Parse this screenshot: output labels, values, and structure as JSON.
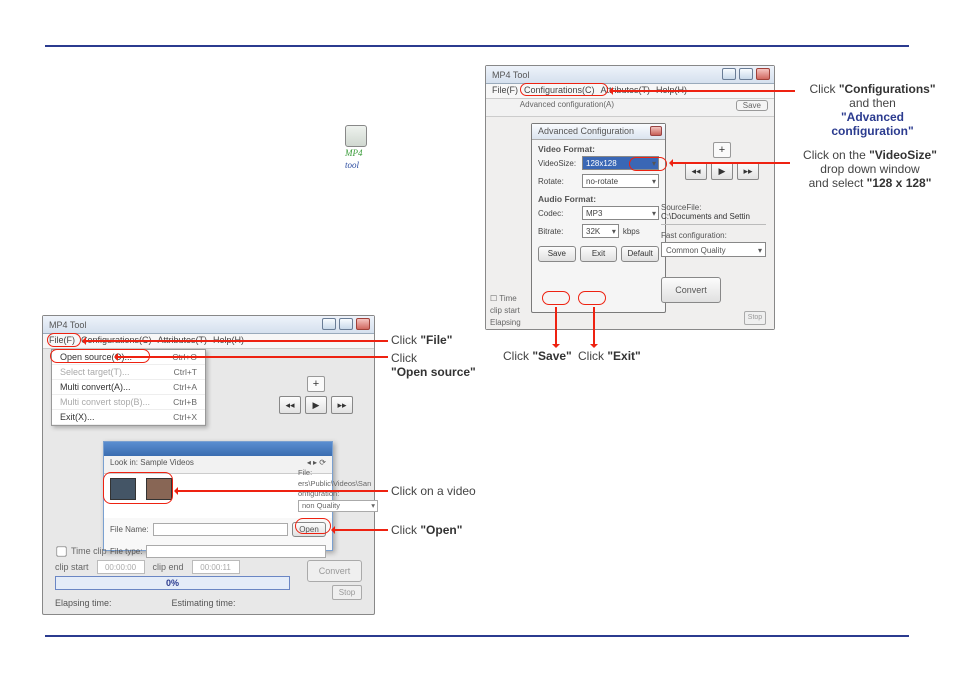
{
  "mp4_icon": {
    "line1": "MP4",
    "line2": "tool"
  },
  "top_window": {
    "title": "MP4 Tool",
    "menu": [
      "File(F)",
      "Configurations(C)",
      "Attributes(T)",
      "Help(H)"
    ],
    "toolbar_hint": "Advanced configuration(A)",
    "save_button": "Save",
    "adv_dialog": {
      "title": "Advanced Configuration",
      "video_section": "Video Format:",
      "videosize_label": "VideoSize:",
      "videosize_value": "128x128",
      "rotate_label": "Rotate:",
      "rotate_value": "no-rotate",
      "audio_section": "Audio Format:",
      "codec_label": "Codec:",
      "codec_value": "MP3",
      "bitrate_label": "Bitrate:",
      "bitrate_value": "32K",
      "bitrate_unit": "kbps",
      "buttons": {
        "save": "Save",
        "exit": "Exit",
        "default": "Default"
      }
    },
    "right_panel": {
      "sourcefile_label": "SourceFile:",
      "sourcefile_value": "C:\\Documents and Settin",
      "fastcfg_label": "Fast configuration:",
      "fastcfg_value": "Common Quality"
    },
    "convert": "Convert",
    "stop": "Stop",
    "timeclip": "Time",
    "clipstart": "clip start",
    "elapsing": "Elapsing"
  },
  "bottom_window": {
    "title": "MP4 Tool",
    "menu": [
      "File(F)",
      "Configurations(C)",
      "Attributes(T)",
      "Help(H)"
    ],
    "file_menu": [
      {
        "label": "Open source(O)...",
        "shortcut": "Ctrl+O",
        "dim": false
      },
      {
        "label": "Select target(T)...",
        "shortcut": "Ctrl+T",
        "dim": true
      },
      {
        "label": "Multi convert(A)...",
        "shortcut": "Ctrl+A",
        "dim": false
      },
      {
        "label": "Multi convert stop(B)...",
        "shortcut": "Ctrl+B",
        "dim": true
      },
      {
        "label": "Exit(X)...",
        "shortcut": "Ctrl+X",
        "dim": false
      }
    ],
    "file_dialog": {
      "lookin_label": "Look in:",
      "lookin_value": "Sample Videos",
      "filename_label": "File Name:",
      "filename_value": "",
      "filetype_label": "File type:",
      "open_btn": "Open"
    },
    "info": {
      "l1": "File:",
      "l2": "ers\\Public\\Videos\\San",
      "l3": "onfiguration:",
      "l4": "non Quality"
    },
    "timeclip_label": "Time clip",
    "clipstart_label": "clip start",
    "clipstart_val": "00:00:00",
    "clipend_label": "clip end",
    "clipend_val": "00:00:11",
    "progress": "0%",
    "elapsing_label": "Elapsing time:",
    "estimating_label": "Estimating time:",
    "convert": "Convert",
    "stop": "Stop"
  },
  "annotations": {
    "a1_pre": "Click ",
    "a1_bold": "\"Configurations\"",
    "a2": "and then",
    "a3": "\"Advanced configuration\"",
    "b1_pre": "Click on the  ",
    "b1_bold": "\"VideoSize\"",
    "b2": "drop down window",
    "b3_pre": "and select ",
    "b3_bold": "\"128 x 128\"",
    "save_pre": "Click ",
    "save_bold": "\"Save\"",
    "exit_pre": "Click ",
    "exit_bold": "\"Exit\"",
    "file_pre": "Click ",
    "file_bold": "\"File\"",
    "os_pre": "Click",
    "os_bold": "\"Open source\"",
    "video": "Click on a video",
    "open_pre": "Click ",
    "open_bold": "\"Open\""
  }
}
